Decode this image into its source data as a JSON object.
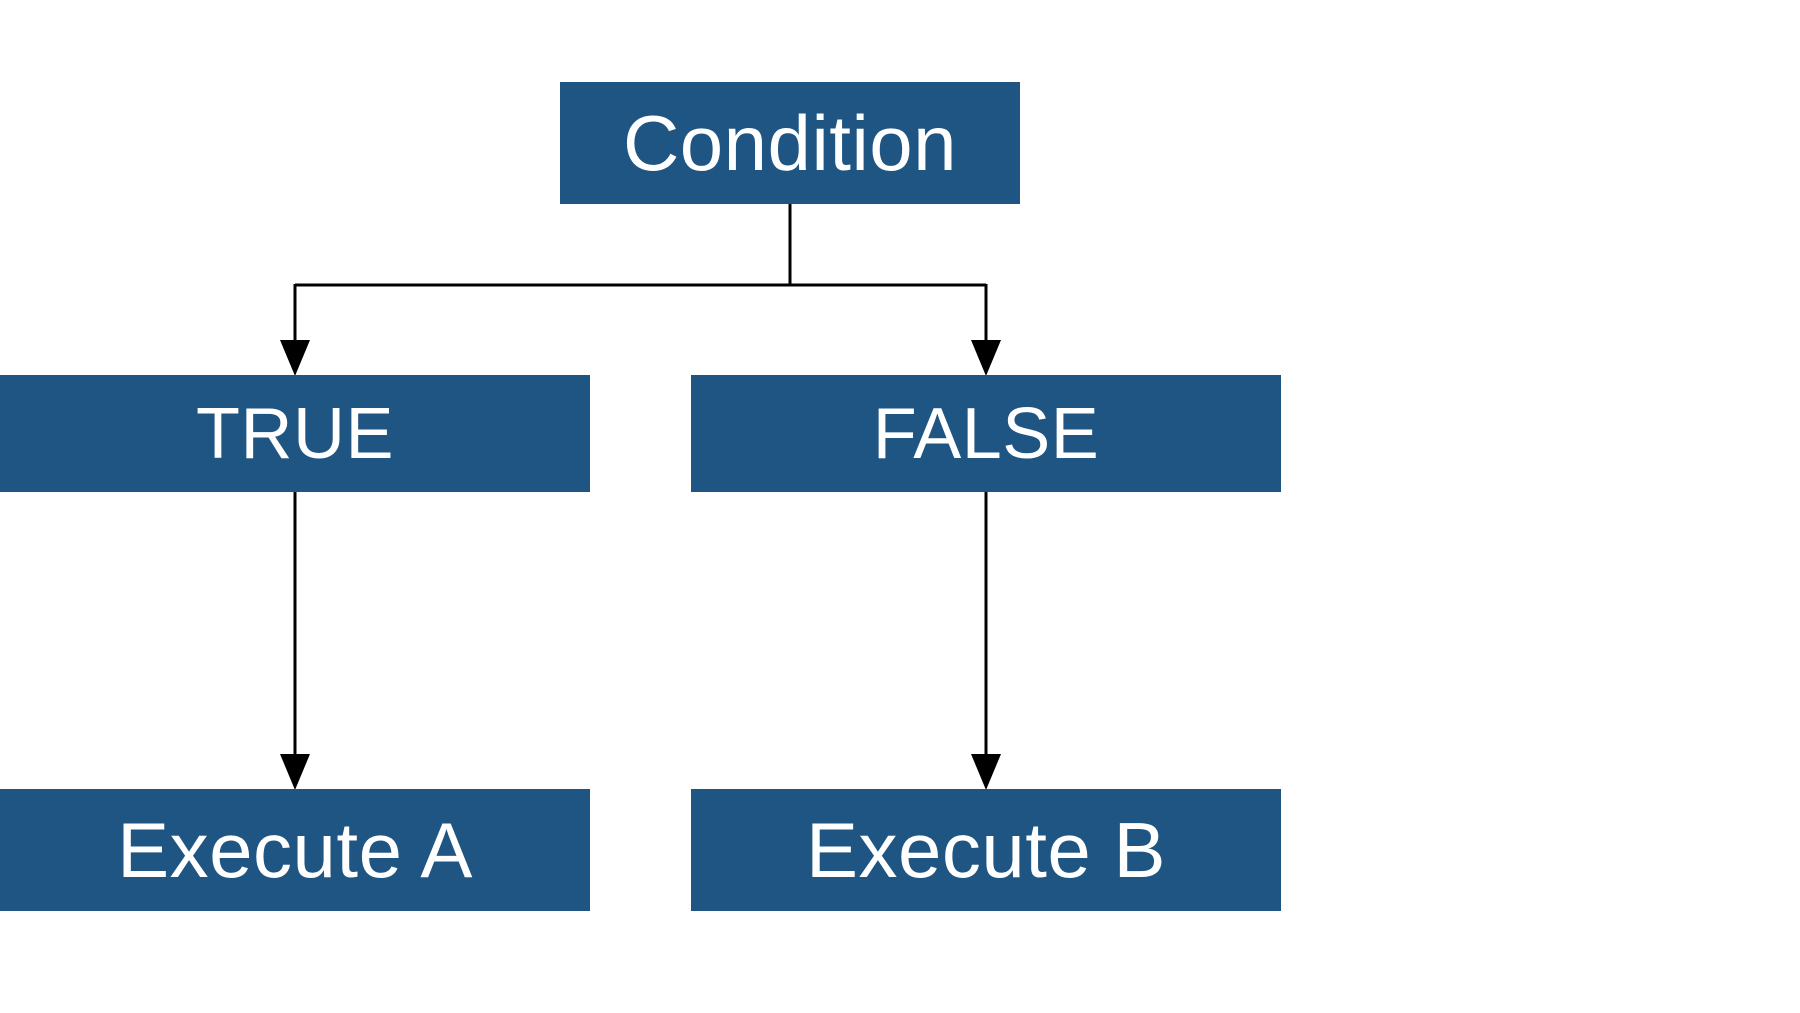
{
  "diagram": {
    "condition": "Condition",
    "true_label": "TRUE",
    "false_label": "FALSE",
    "execute_a": "Execute A",
    "execute_b": "Execute B"
  },
  "colors": {
    "box_bg": "#1f5582",
    "box_text": "#ffffff",
    "connector": "#000000"
  }
}
